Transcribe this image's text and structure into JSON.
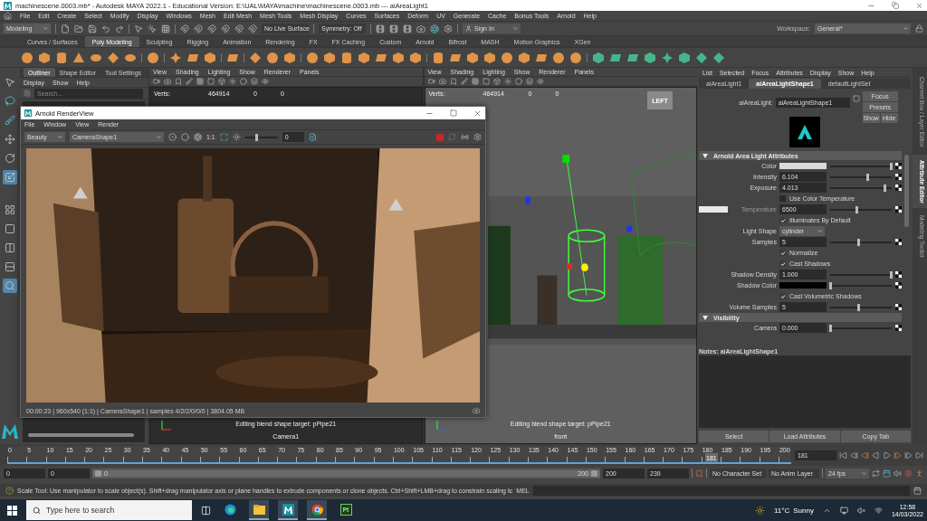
{
  "window": {
    "title": "machinescene.0003.mb* - Autodesk MAYA 2022.1 - Educational Version: E:\\UAL\\MAYA\\machine\\machinescene.0003.mb  ---  aiAreaLight1"
  },
  "menubar": [
    "File",
    "Edit",
    "Create",
    "Select",
    "Modify",
    "Display",
    "Windows",
    "Mesh",
    "Edit Mesh",
    "Mesh Tools",
    "Mesh Display",
    "Curves",
    "Surfaces",
    "Deform",
    "UV",
    "Generate",
    "Cache",
    "Bonus Tools",
    "Arnold",
    "Help"
  ],
  "status_line": {
    "mode": "Modeling",
    "live_surface": "No Live Surface",
    "symmetry": "Symmetry: Off",
    "sign_in": "Sign In",
    "workspace_label": "Workspace:",
    "workspace": "General*"
  },
  "shelf_tabs": [
    {
      "label": "Curves / Surfaces",
      "selected": false
    },
    {
      "label": "Poly Modeling",
      "selected": true
    },
    {
      "label": "Sculpting",
      "selected": false
    },
    {
      "label": "Rigging",
      "selected": false
    },
    {
      "label": "Animation",
      "selected": false
    },
    {
      "label": "Rendering",
      "selected": false
    },
    {
      "label": "FX",
      "selected": false
    },
    {
      "label": "FX Caching",
      "selected": false
    },
    {
      "label": "Custom",
      "selected": false
    },
    {
      "label": "Arnold",
      "selected": false
    },
    {
      "label": "Bifrost",
      "selected": false
    },
    {
      "label": "MASH",
      "selected": false
    },
    {
      "label": "Motion Graphics",
      "selected": false
    },
    {
      "label": "XGen",
      "selected": false
    }
  ],
  "outliner": {
    "tabs": [
      {
        "label": "Outliner",
        "selected": true
      },
      {
        "label": "Shape Editor",
        "selected": false
      },
      {
        "label": "Tool Settings",
        "selected": false
      }
    ],
    "menu": [
      "Display",
      "Show",
      "Help"
    ],
    "search": {
      "placeholder": "Search..."
    }
  },
  "viewports": [
    {
      "menu": [
        "View",
        "Shading",
        "Lighting",
        "Show",
        "Renderer",
        "Panels"
      ],
      "stats": [
        {
          "label": "Verts:",
          "values": [
            "464914",
            "0",
            "0"
          ]
        }
      ],
      "hud": "Editing blend shape target: pPipe21",
      "camera": "Camera1"
    },
    {
      "menu": [
        "View",
        "Shading",
        "Lighting",
        "Show",
        "Renderer",
        "Panels"
      ],
      "stats": [
        {
          "label": "Verts:",
          "values": [
            "464914",
            "0",
            "0"
          ]
        }
      ],
      "view_cube": "LEFT",
      "hud": "Editing blend shape target: pPipe21",
      "camera": "front"
    }
  ],
  "render_view": {
    "title": "Arnold RenderView",
    "menu": [
      "File",
      "Window",
      "View",
      "Render"
    ],
    "aov": "Beauty",
    "camera": "CameraShape1",
    "zoom": "1:1",
    "exposure": "0",
    "exposure_slider": {
      "level": 0.35
    },
    "status": "00:00:23 | 960x540 (1:1) | CameraShape1  | samples 4/2/2/0/0/0 | 3804.05 MB"
  },
  "attribute_editor": {
    "menu": [
      "List",
      "Selected",
      "Focus",
      "Attributes",
      "Display",
      "Show",
      "Help"
    ],
    "tabs": [
      {
        "label": "aiAreaLight1",
        "selected": false
      },
      {
        "label": "aiAreaLightShape1",
        "selected": true
      },
      {
        "label": "defaultLightSet",
        "selected": false
      }
    ],
    "node_label": "aiAreaLight:",
    "node_name": "aiAreaLightShape1",
    "buttons": [
      "Focus",
      "Presets",
      "Show",
      "Hide"
    ],
    "sections": [
      {
        "title": "Arnold Area Light Attributes",
        "expanded": true,
        "rows": [
          {
            "kind": "color",
            "label": "Color",
            "color": "#d9d9d9",
            "level": 0.98,
            "disabled": false
          },
          {
            "kind": "number",
            "label": "Intensity",
            "value": "6.104",
            "level": 0.6,
            "disabled": false
          },
          {
            "kind": "number",
            "label": "Exposure",
            "value": "4.013",
            "level": 0.88,
            "disabled": false
          },
          {
            "kind": "checkbox",
            "label": "Use Color Temperature",
            "checked": false,
            "disabled": false
          },
          {
            "kind": "number",
            "label": "Temperature",
            "value": "6500",
            "level": 0.42,
            "disabled": true,
            "color": "#e8e8e8"
          },
          {
            "kind": "checkbox",
            "label": "Illuminates By Default",
            "checked": true,
            "disabled": false
          },
          {
            "kind": "dropdown",
            "label": "Light Shape",
            "value": "cylinder",
            "disabled": false
          },
          {
            "kind": "number",
            "label": "Samples",
            "value": "5",
            "level": 0.45,
            "disabled": false
          },
          {
            "kind": "checkbox",
            "label": "Normalize",
            "checked": true,
            "disabled": false
          },
          {
            "kind": "checkbox",
            "label": "Cast Shadows",
            "checked": true,
            "disabled": false
          },
          {
            "kind": "number",
            "label": "Shadow Density",
            "value": "1.000",
            "level": 0.98,
            "disabled": false
          },
          {
            "kind": "color",
            "label": "Shadow Color",
            "color": "#000000",
            "level": 0,
            "disabled": false
          },
          {
            "kind": "checkbox",
            "label": "Cast Volumetric Shadows",
            "checked": true,
            "disabled": false
          },
          {
            "kind": "number",
            "label": "Volume Samples",
            "value": "5",
            "level": 0.45,
            "disabled": false
          }
        ]
      },
      {
        "title": "Visibility",
        "expanded": true,
        "rows": [
          {
            "kind": "number",
            "label": "Camera",
            "value": "0.000",
            "level": 0,
            "disabled": false
          }
        ]
      }
    ],
    "notes_label": "Notes:  aiAreaLightShape1",
    "footer_buttons": [
      "Select",
      "Load Attributes",
      "Copy Tab"
    ]
  },
  "side_tabs": [
    {
      "label": "Channel Box / Layer Editor",
      "selected": false
    },
    {
      "label": "Attribute Editor",
      "selected": true
    },
    {
      "label": "Modeling Toolkit",
      "selected": false
    }
  ],
  "timeline": {
    "ticks": [
      "0",
      "5",
      "10",
      "15",
      "20",
      "25",
      "30",
      "35",
      "40",
      "45",
      "50",
      "55",
      "60",
      "65",
      "70",
      "75",
      "80",
      "85",
      "90",
      "95",
      "100",
      "105",
      "110",
      "115",
      "120",
      "125",
      "130",
      "135",
      "140",
      "145",
      "150",
      "155",
      "160",
      "165",
      "170",
      "175",
      "180",
      "185",
      "190",
      "195",
      "200"
    ],
    "current": "181",
    "level": 0.905,
    "frame_field": "181"
  },
  "range": {
    "start": "0",
    "playback_start": "0",
    "slider_start": "0",
    "slider_end": "200",
    "slider": {
      "level": 1
    },
    "playback_end": "200",
    "end": "239",
    "character_set": "No Character Set",
    "anim_layer": "No Anim Layer",
    "fps": "24 fps"
  },
  "help_line": {
    "text": "Scale Tool: Use manipulator to scale object(s). Shift+drag manipulator axis or plane handles to extrude components or clone objects. Ctrl+Shift+LMB+drag to constrain scaling tc",
    "command_label": "MEL"
  },
  "taskbar": {
    "search_placeholder": "Type here to search",
    "app_label": "Pt",
    "temperature": "11°C",
    "weather": "Sunny",
    "time": "12:58",
    "date": "14/03/2022"
  }
}
